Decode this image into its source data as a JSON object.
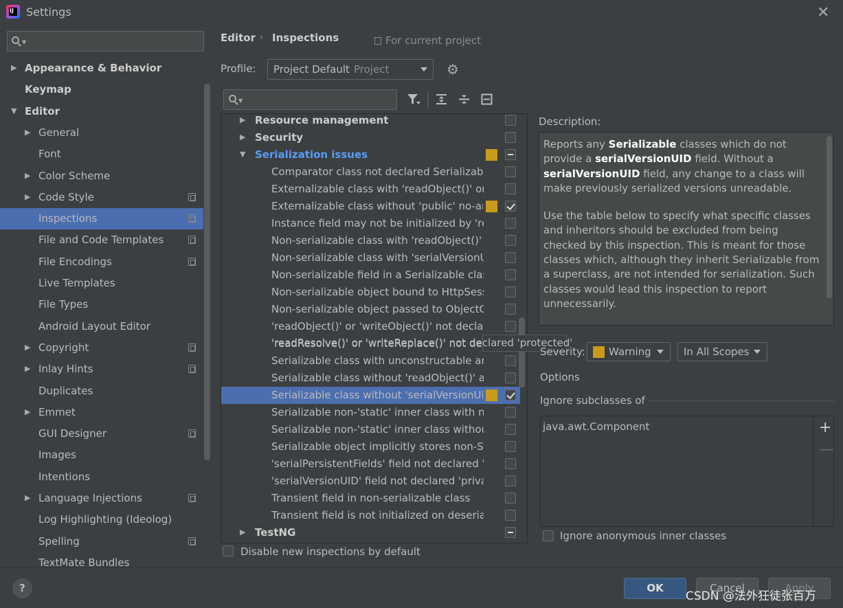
{
  "window": {
    "title": "Settings"
  },
  "sidebar": {
    "items": [
      {
        "label": "Appearance & Behavior",
        "arrow": "▶",
        "bold": true,
        "level": 0
      },
      {
        "label": "Keymap",
        "arrow": "",
        "bold": true,
        "level": 0
      },
      {
        "label": "Editor",
        "arrow": "▼",
        "bold": true,
        "level": 0
      },
      {
        "label": "General",
        "arrow": "▶",
        "level": 1
      },
      {
        "label": "Font",
        "arrow": "",
        "level": 1
      },
      {
        "label": "Color Scheme",
        "arrow": "▶",
        "level": 1
      },
      {
        "label": "Code Style",
        "arrow": "▶",
        "level": 1,
        "project": true
      },
      {
        "label": "Inspections",
        "arrow": "",
        "level": 1,
        "project": true,
        "selected": true
      },
      {
        "label": "File and Code Templates",
        "arrow": "",
        "level": 1,
        "project": true
      },
      {
        "label": "File Encodings",
        "arrow": "",
        "level": 1,
        "project": true
      },
      {
        "label": "Live Templates",
        "arrow": "",
        "level": 1
      },
      {
        "label": "File Types",
        "arrow": "",
        "level": 1
      },
      {
        "label": "Android Layout Editor",
        "arrow": "",
        "level": 1
      },
      {
        "label": "Copyright",
        "arrow": "▶",
        "level": 1,
        "project": true
      },
      {
        "label": "Inlay Hints",
        "arrow": "▶",
        "level": 1,
        "project": true
      },
      {
        "label": "Duplicates",
        "arrow": "",
        "level": 1
      },
      {
        "label": "Emmet",
        "arrow": "▶",
        "level": 1
      },
      {
        "label": "GUI Designer",
        "arrow": "",
        "level": 1,
        "project": true
      },
      {
        "label": "Images",
        "arrow": "",
        "level": 1
      },
      {
        "label": "Intentions",
        "arrow": "",
        "level": 1
      },
      {
        "label": "Language Injections",
        "arrow": "▶",
        "level": 1,
        "project": true
      },
      {
        "label": "Log Highlighting (Ideolog)",
        "arrow": "",
        "level": 1
      },
      {
        "label": "Spelling",
        "arrow": "",
        "level": 1,
        "project": true
      },
      {
        "label": "TextMate Bundles",
        "arrow": "",
        "level": 1
      }
    ]
  },
  "header": {
    "crumb1": "Editor",
    "crumb_sep": "›",
    "crumb2": "Inspections",
    "for_project": "For current project"
  },
  "profile": {
    "label": "Profile:",
    "value": "Project Default",
    "kind": "Project"
  },
  "tree": {
    "rows": [
      {
        "text": "Resource management",
        "level": 0,
        "arrow": "▶",
        "bold": true,
        "check": "none"
      },
      {
        "text": "Security",
        "level": 0,
        "arrow": "▶",
        "bold": true,
        "check": "none"
      },
      {
        "text": "Serialization issues",
        "level": 0,
        "arrow": "▼",
        "bold": true,
        "blue": true,
        "sev": true,
        "check": "mixed"
      },
      {
        "text": "Comparator class not declared Serializable",
        "level": 1,
        "check": "none"
      },
      {
        "text": "Externalizable class with 'readObject()' or 'w",
        "level": 1,
        "check": "none"
      },
      {
        "text": "Externalizable class without 'public' no-arg",
        "level": 1,
        "sev": true,
        "check": "checked"
      },
      {
        "text": "Instance field may not be initialized by 'rea",
        "level": 1,
        "check": "none"
      },
      {
        "text": "Non-serializable class with 'readObject()' o",
        "level": 1,
        "check": "none"
      },
      {
        "text": "Non-serializable class with 'serialVersionUID",
        "level": 1,
        "check": "none"
      },
      {
        "text": "Non-serializable field in a Serializable class",
        "level": 1,
        "check": "none"
      },
      {
        "text": "Non-serializable object bound to HttpSess",
        "level": 1,
        "check": "none"
      },
      {
        "text": "Non-serializable object passed to ObjectO",
        "level": 1,
        "check": "none"
      },
      {
        "text": "'readObject()' or 'writeObject()' not declare",
        "level": 1,
        "check": "none"
      },
      {
        "text": "'readResolve()' or 'writeReplace()' not declared 'protected'",
        "level": 1,
        "check": "none",
        "tooltip": true
      },
      {
        "text": "Serializable class with unconstructable anc",
        "level": 1,
        "check": "none"
      },
      {
        "text": "Serializable class without 'readObject()' and",
        "level": 1,
        "check": "none"
      },
      {
        "text": "Serializable class without 'serialVersionUID",
        "level": 1,
        "sev": true,
        "check": "checked",
        "selected": true
      },
      {
        "text": "Serializable non-'static' inner class with non",
        "level": 1,
        "check": "none"
      },
      {
        "text": "Serializable non-'static' inner class without",
        "level": 1,
        "check": "none"
      },
      {
        "text": "Serializable object implicitly stores non-Se",
        "level": 1,
        "check": "none"
      },
      {
        "text": "'serialPersistentFields' field not declared 'p",
        "level": 1,
        "check": "none"
      },
      {
        "text": "'serialVersionUID' field not declared 'privat",
        "level": 1,
        "check": "none"
      },
      {
        "text": "Transient field in non-serializable class",
        "level": 1,
        "check": "none"
      },
      {
        "text": "Transient field is not initialized on deseriali",
        "level": 1,
        "check": "none"
      },
      {
        "text": "TestNG",
        "level": 0,
        "arrow": "▶",
        "bold": true,
        "check": "mixed"
      }
    ]
  },
  "disable_new": "Disable new inspections by default",
  "description": {
    "label": "Description:",
    "p1_a": "Reports any ",
    "p1_b": "Serializable",
    "p1_c": " classes which do not provide a ",
    "p1_d": "serialVersionUID",
    "p1_e": " field. Without a ",
    "p1_f": "serialVersionUID",
    "p1_g": " field, any change to a class will make previously serialized versions unreadable.",
    "p2": "Use the table below to specify what specific classes and inheritors should be excluded from being checked by this inspection. This is meant for those classes which, although they inherit Serializable from a superclass, are not intended for serialization. Such classes would lead this inspection to report unnecessarily."
  },
  "severity": {
    "label": "Severity:",
    "value": "Warning",
    "scope": "In All Scopes",
    "color": "#c89b1a"
  },
  "options": {
    "label": "Options",
    "ignore_subclasses": "Ignore subclasses of",
    "list": [
      "java.awt.Component"
    ],
    "plus": "+",
    "minus": "—",
    "ignore_anonymous": "Ignore anonymous inner classes"
  },
  "buttons": {
    "help": "?",
    "ok": "OK",
    "cancel": "Cancel",
    "apply": "Apply"
  },
  "watermark": "CSDN @法外狂徒张百万"
}
